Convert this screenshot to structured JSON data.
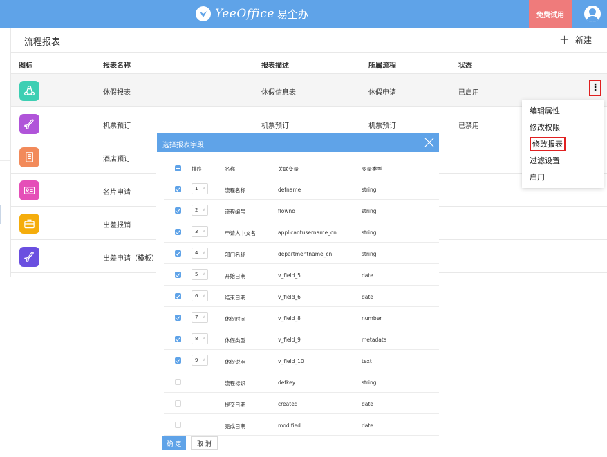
{
  "header": {
    "brand_name": "YeeOffice",
    "brand_cn": "易企办",
    "trial_label": "免费试用"
  },
  "page": {
    "title": "流程报表",
    "new_label": "新建"
  },
  "table": {
    "columns": [
      "图标",
      "报表名称",
      "报表描述",
      "所属流程",
      "状态"
    ],
    "rows": [
      {
        "icon": "users-cycle-icon",
        "color": "#3dcfb3",
        "name": "休假报表",
        "desc": "休假信息表",
        "process": "休假申请",
        "status": "已启用"
      },
      {
        "icon": "airplane-icon",
        "color": "#b054d9",
        "name": "机票预订",
        "desc": "机票预订",
        "process": "机票预订",
        "status": "已禁用"
      },
      {
        "icon": "hotel-icon",
        "color": "#f28a5a",
        "name": "酒店预订",
        "desc": "",
        "process": "",
        "status": ""
      },
      {
        "icon": "business-card-icon",
        "color": "#e54fb8",
        "name": "名片申请",
        "desc": "",
        "process": "",
        "status": ""
      },
      {
        "icon": "briefcase-icon",
        "color": "#f5ad0c",
        "name": "出差报销",
        "desc": "",
        "process": "",
        "status": ""
      },
      {
        "icon": "airplane-icon",
        "color": "#6a4fe0",
        "name": "出差申请（模板）",
        "desc": "",
        "process": "",
        "status": ""
      }
    ]
  },
  "menu": {
    "items": [
      "编辑属性",
      "修改权限",
      "修改报表",
      "过滤设置",
      "启用"
    ]
  },
  "modal": {
    "title": "选择报表字段",
    "columns": [
      "排序",
      "名称",
      "关联变量",
      "变量类型"
    ],
    "fields": [
      {
        "checked": true,
        "order": "1",
        "name": "流程名称",
        "var": "defname",
        "type": "string"
      },
      {
        "checked": true,
        "order": "2",
        "name": "流程编号",
        "var": "flowno",
        "type": "string"
      },
      {
        "checked": true,
        "order": "3",
        "name": "申请人中文名",
        "var": "applicantusername_cn",
        "type": "string"
      },
      {
        "checked": true,
        "order": "4",
        "name": "部门名称",
        "var": "departmentname_cn",
        "type": "string"
      },
      {
        "checked": true,
        "order": "5",
        "name": "开始日期",
        "var": "v_field_5",
        "type": "date"
      },
      {
        "checked": true,
        "order": "6",
        "name": "结束日期",
        "var": "v_field_6",
        "type": "date"
      },
      {
        "checked": true,
        "order": "7",
        "name": "休假时间",
        "var": "v_field_8",
        "type": "number"
      },
      {
        "checked": true,
        "order": "8",
        "name": "休假类型",
        "var": "v_field_9",
        "type": "metadata"
      },
      {
        "checked": true,
        "order": "9",
        "name": "休假说明",
        "var": "v_field_10",
        "type": "text"
      },
      {
        "checked": false,
        "order": "",
        "name": "流程标识",
        "var": "defkey",
        "type": "string"
      },
      {
        "checked": false,
        "order": "",
        "name": "提交日期",
        "var": "created",
        "type": "date"
      },
      {
        "checked": false,
        "order": "",
        "name": "完成日期",
        "var": "modified",
        "type": "date"
      }
    ],
    "ok_label": "确 定",
    "cancel_label": "取 消"
  },
  "colors": {
    "primary": "#5fa3e8",
    "trial": "#ef7b7b",
    "highlight_border": "#e02020"
  }
}
